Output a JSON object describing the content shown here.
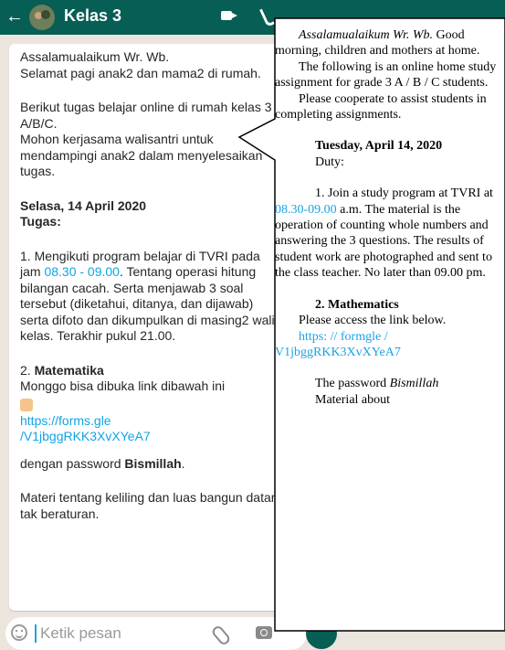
{
  "header": {
    "back": "←",
    "title": "Kelas 3"
  },
  "message": {
    "greeting": "Assalamualaikum Wr. Wb.",
    "greeting2": "Selamat pagi anak2 dan mama2 di rumah.",
    "intro": "Berikut tugas belajar online di rumah kelas 3 A/B/C.",
    "cooperate": "Mohon kerjasama walisantri untuk mendampingi anak2 dalam menyelesaikan tugas.",
    "date": "Selasa, 14 April 2020",
    "tugas": "Tugas:",
    "task1_a": "1. Mengikuti program belajar di TVRI pada jam ",
    "task1_time": "08.30 - 09.00",
    "task1_b": ". Tentang operasi hitung bilangan cacah. Serta menjawab 3 soal tersebut (diketahui, ditanya, dan dijawab) serta difoto dan dikumpulkan di masing2 wali kelas. Terakhir pukul 21.00.",
    "task2_num": "2. ",
    "task2_subject": "Matematika",
    "task2_text": "Monggo bisa dibuka link dibawah ini",
    "link_line1": "https://forms.gle",
    "link_line2": "/V1jbggRKK3XvXYeA7",
    "password_prefix": "dengan password ",
    "password": "Bismillah",
    "password_suffix": ".",
    "materi": "Materi tentang keliling dan luas bangun datar tak beraturan."
  },
  "input": {
    "placeholder": "Ketik pesan"
  },
  "translation": {
    "greet_italic": "Assalamualaikum Wr. Wb.",
    "greet_rest": " Good morning, children and mothers at home.",
    "following": "The following is an online home study assignment for grade 3 A / B / C students.",
    "cooperate": "Please cooperate to assist students in completing assignments.",
    "date": "Tuesday, April 14, 2020",
    "duty": "Duty:",
    "task1_a": "1. Join a study program at TVRI at ",
    "task1_time": "08.30-09.00",
    "task1_b": " a.m. The material is the operation of counting whole numbers and answering the 3 questions. The results of student work are photographed and sent to the class teacher. No later than 09.00 pm.",
    "math_heading": "2. Mathematics",
    "access": "Please access the link below.",
    "link": "https: // formgle / V1jbggRKK3XvXYeA7",
    "password_prefix": "The password ",
    "password": "Bismillah",
    "material": "Material about"
  }
}
